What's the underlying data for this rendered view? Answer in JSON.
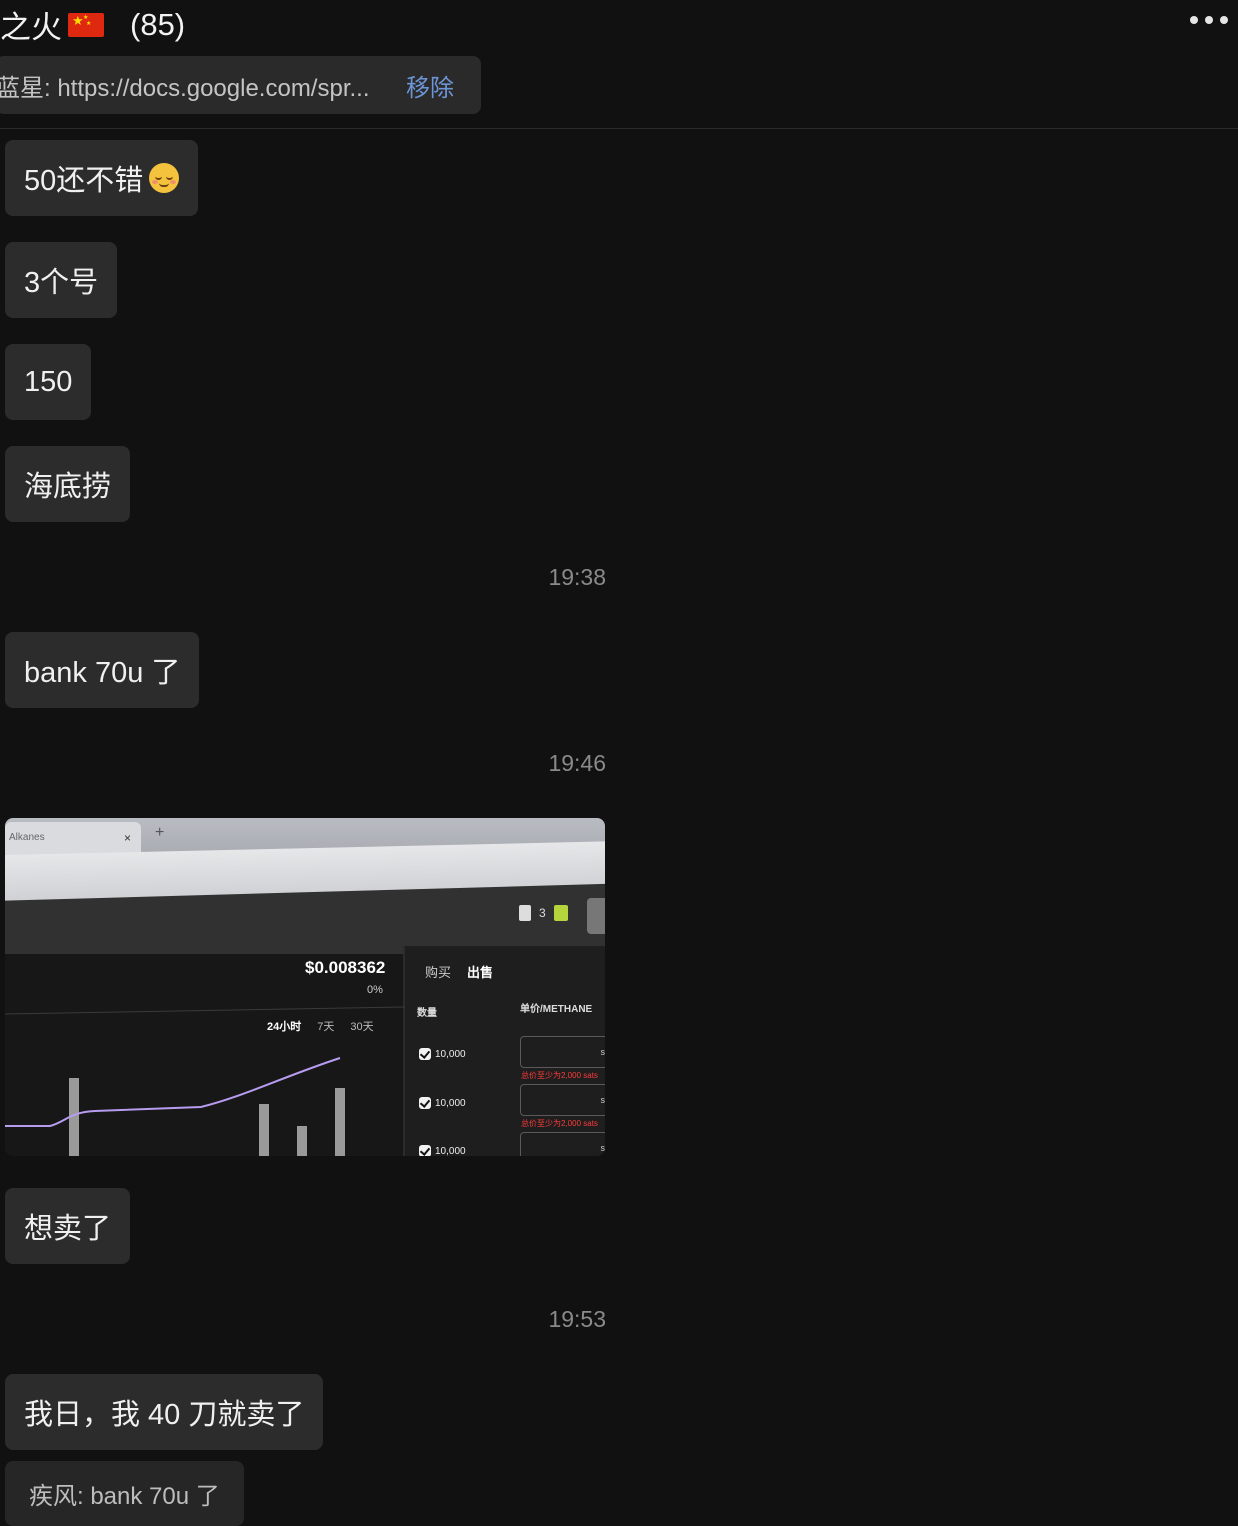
{
  "header": {
    "title": "之火",
    "member_count": "(85)",
    "more_icon": "more-dots-icon"
  },
  "pinned": {
    "text": "蓝星: https://docs.google.com/spr...",
    "remove_label": "移除"
  },
  "messages": [
    {
      "type": "text",
      "text": "50还不错",
      "emoji": "relieved-face"
    },
    {
      "type": "text",
      "text": "3个号"
    },
    {
      "type": "text",
      "text": "150"
    },
    {
      "type": "text",
      "text": "海底捞"
    },
    {
      "type": "time",
      "text": "19:38"
    },
    {
      "type": "text",
      "text": "bank 70u 了"
    },
    {
      "type": "time",
      "text": "19:46"
    },
    {
      "type": "image"
    },
    {
      "type": "text",
      "text": "想卖了"
    },
    {
      "type": "time",
      "text": "19:53"
    },
    {
      "type": "text",
      "text": "我日，我 40 刀就卖了"
    },
    {
      "type": "quote",
      "text": "疾风: bank 70u 了"
    }
  ],
  "photo": {
    "tab_title": "Alkanes",
    "tab_close": "×",
    "tab_new": "+",
    "gas_count": "3",
    "price": "$0.008362",
    "change": "0%",
    "periods": [
      "24小时",
      "7天",
      "30天"
    ],
    "buy_label": "购买",
    "sell_label": "出售",
    "qty_header": "数量",
    "unit_header": "单价/METHANE",
    "rows": [
      {
        "qty": "10,000",
        "unit": "s",
        "warning": "总价至少为2,000 sats"
      },
      {
        "qty": "10,000",
        "unit": "s",
        "warning": "总价至少为2,000 sats"
      },
      {
        "qty": "10,000",
        "unit": "s",
        "warning": ""
      }
    ]
  }
}
